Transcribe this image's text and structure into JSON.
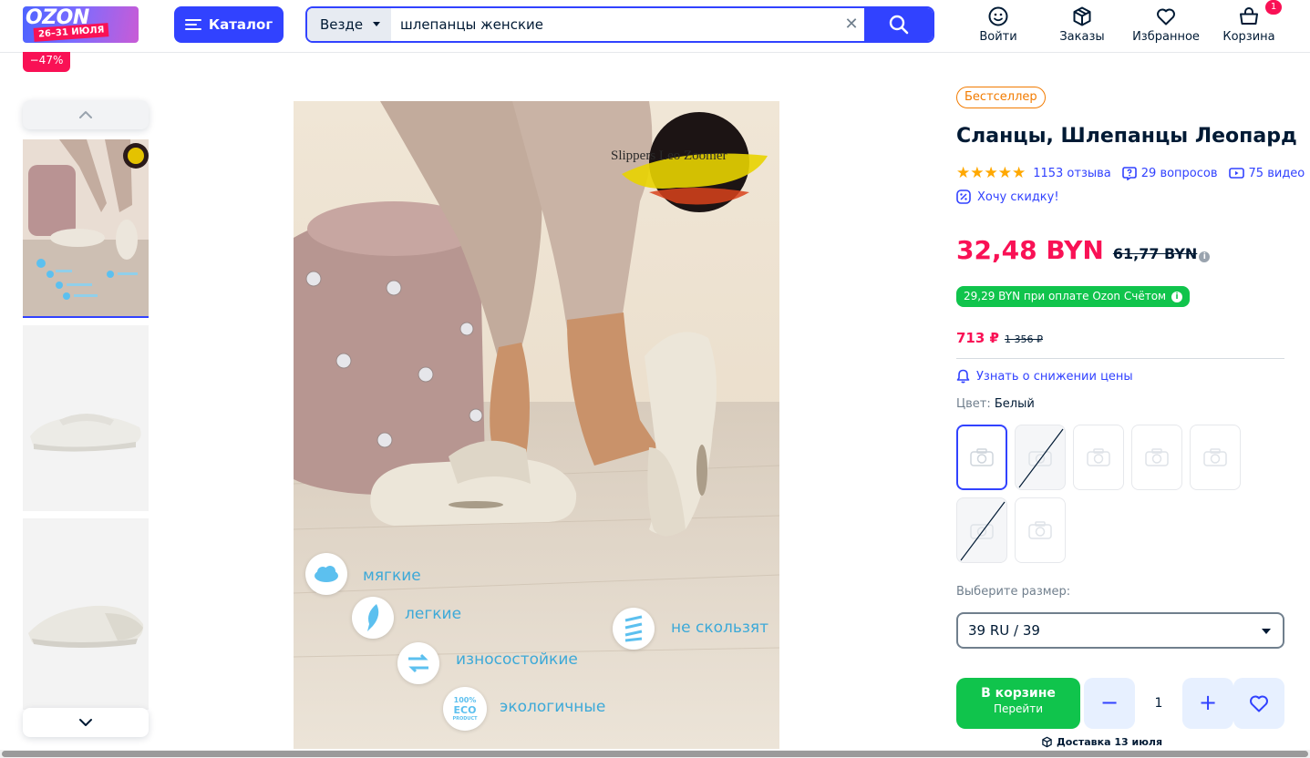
{
  "header": {
    "logo_text": "OZON",
    "promo_dates": "26–31 ИЮЛЯ",
    "catalog_label": "Каталог",
    "search_scope": "Везде",
    "search_value": "шлепанцы женские",
    "actions": {
      "login": "Войти",
      "orders": "Заказы",
      "favorites": "Избранное",
      "cart": "Корзина",
      "cart_count": "1"
    }
  },
  "gallery": {
    "discount": "−47%",
    "main_image": {
      "brand_text": "Slippers Leo Zoomer",
      "features": [
        "мягкие",
        "легкие",
        "износостойкие",
        "экологичные",
        "не скользят"
      ],
      "eco_badge": [
        "100%",
        "ECO",
        "PRODUCT"
      ]
    }
  },
  "product": {
    "badge": "Бестселлер",
    "title": "Сланцы, Шлепанцы Леопард",
    "rating_stars": "★★★★★",
    "reviews": "1153 отзыва",
    "questions": "29 вопросов",
    "videos": "75 видео",
    "want_discount": "Хочу скидку!",
    "price": "32,48 BYN",
    "old_price": "61,77 BYN",
    "card_price": "29,29 BYN при оплате Ozon Счётом",
    "rub_price": "713 ₽",
    "rub_old_price": "1 356 ₽",
    "price_alert": "Узнать о снижении цены",
    "color_label": "Цвет:",
    "color_value": "Белый",
    "size_label": "Выберите размер:",
    "size_value": "39 RU / 39",
    "cart_button": "В корзине",
    "cart_button_sub": "Перейти",
    "quantity": "1",
    "delivery": "Доставка 13 июля"
  },
  "colors": {
    "accent": "#3142ff",
    "sale": "#f91155",
    "green": "#10c44c",
    "badge_orange": "#f27b00"
  }
}
